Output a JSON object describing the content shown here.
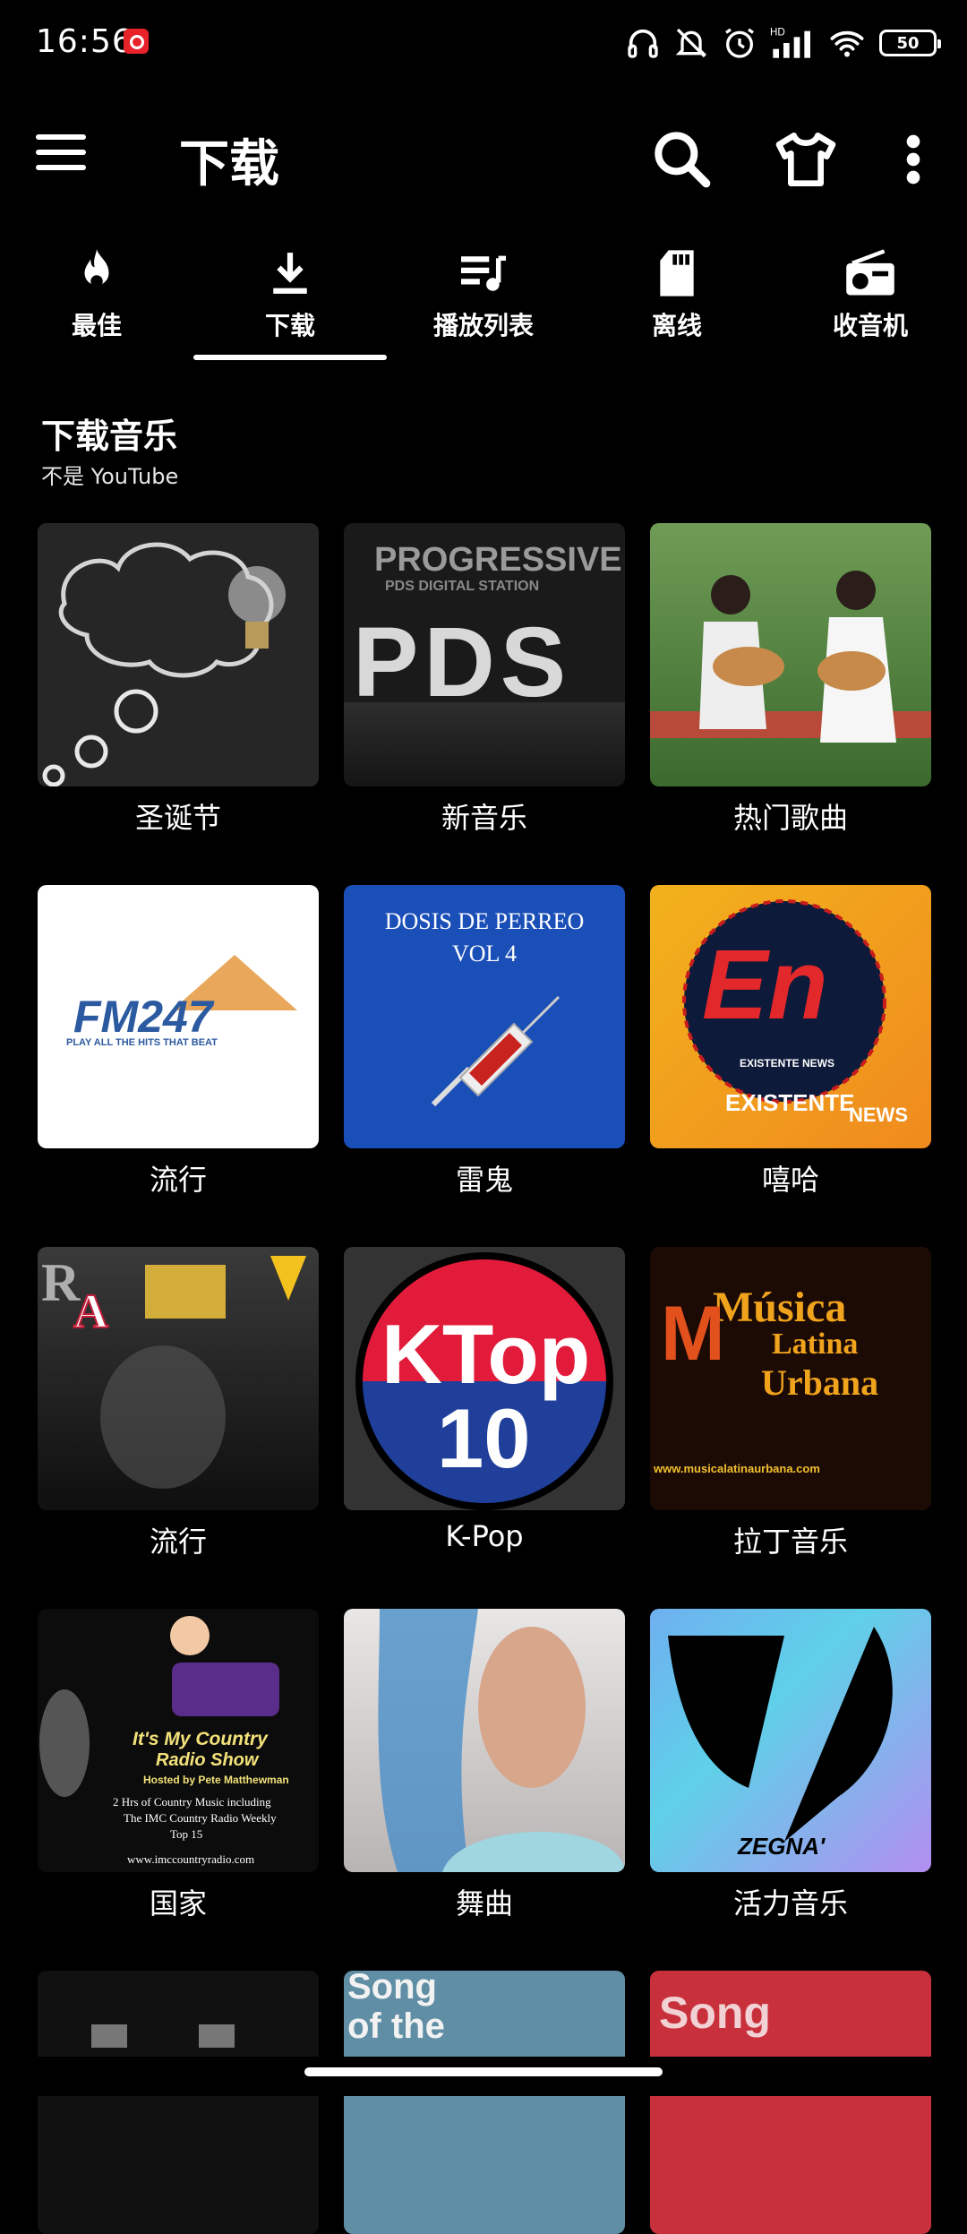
{
  "status": {
    "time": "16:56",
    "battery": "50"
  },
  "appbar": {
    "title": "下载"
  },
  "tabs": [
    {
      "label": "最佳",
      "icon": "flame-icon"
    },
    {
      "label": "下载",
      "icon": "download-icon",
      "active": true
    },
    {
      "label": "播放列表",
      "icon": "playlist-icon"
    },
    {
      "label": "离线",
      "icon": "sd-card-icon"
    },
    {
      "label": "收音机",
      "icon": "radio-icon"
    }
  ],
  "section": {
    "title": "下载音乐",
    "subtitle": "不是 YouTube"
  },
  "cards": [
    {
      "caption": "圣诞节"
    },
    {
      "caption": "新音乐",
      "art_text": [
        "PROGRESSIVE",
        "PDS DIGITAL STATION",
        "PDS"
      ]
    },
    {
      "caption": "热门歌曲"
    },
    {
      "caption": "流行",
      "art_text": [
        "FM247",
        "PLAY ALL THE HITS THAT BEAT"
      ]
    },
    {
      "caption": "雷鬼",
      "art_text": [
        "DOSIS DE PERREO",
        "VOL 4"
      ]
    },
    {
      "caption": "嘻哈",
      "art_text": [
        "EXISTENTE NEWS",
        "EXISTENTE",
        "NEWS"
      ]
    },
    {
      "caption": "流行"
    },
    {
      "caption": "K-Pop",
      "art_text": [
        "KTop",
        "10"
      ]
    },
    {
      "caption": "拉丁音乐",
      "art_text": [
        "Música",
        "Latina",
        "Urbana",
        "www.musicalatinaurbana.com"
      ]
    },
    {
      "caption": "国家",
      "art_text": [
        "It's My Country",
        "Radio Show",
        "Hosted by Pete Matthewman",
        "2 Hrs of Country Music including",
        "The IMC Country Radio Weekly",
        "Top 15",
        "www.imccountryradio.com"
      ]
    },
    {
      "caption": "舞曲"
    },
    {
      "caption": "活力音乐",
      "art_text": [
        "ZEGNA'"
      ]
    },
    {
      "caption": "",
      "art_text": []
    },
    {
      "caption": "",
      "art_text": [
        "Song",
        "of the"
      ]
    },
    {
      "caption": "",
      "art_text": [
        "Song"
      ]
    }
  ],
  "colors": {
    "background": "#000000",
    "text": "#ffffff"
  }
}
